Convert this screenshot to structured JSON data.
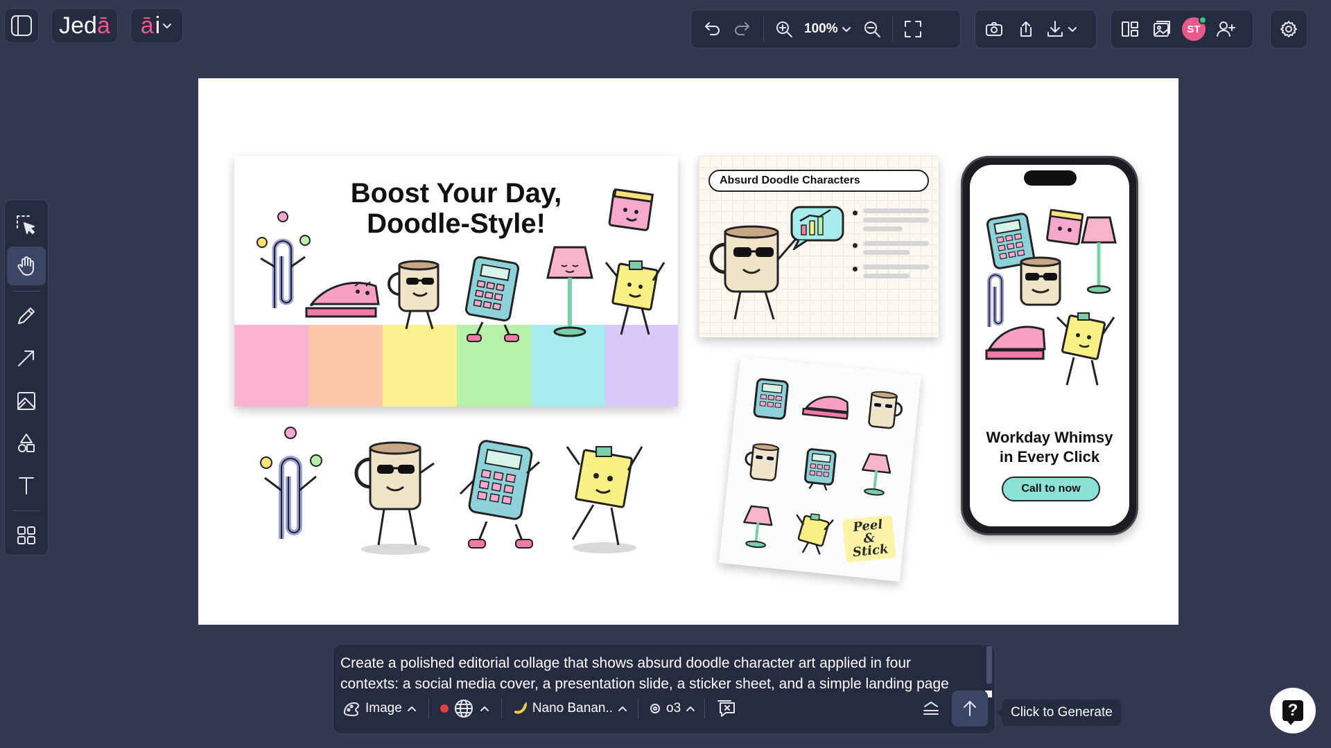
{
  "app": {
    "logo_main": "Jed",
    "logo_accent": "ā",
    "ai_main": "ā",
    "ai_tail": "i"
  },
  "toolbar": {
    "zoom_value": "100%"
  },
  "user": {
    "initials": "ST"
  },
  "canvas": {
    "social": {
      "title_line1": "Boost Your Day,",
      "title_line2": "Doodle-Style!"
    },
    "slide": {
      "title": "Absurd Doodle Characters"
    },
    "sticker_sheet": {
      "label_line1": "Peel &",
      "label_line2": "Stick"
    },
    "phone": {
      "headline_line1": "Workday Whimsy",
      "headline_line2": "in Every Click",
      "cta": "Call to now"
    }
  },
  "prompt": {
    "text": "Create a polished editorial collage that shows absurd doodle character art applied in four contexts: a social media cover, a presentation slide, a sticker sheet, and a simple landing page",
    "mode_label": "Image",
    "model_label": "Nano Banan..",
    "reasoning_label": "o3",
    "generate_tooltip": "Click to Generate"
  },
  "help": {
    "glyph": "?"
  },
  "colors": {
    "background": "#323852",
    "panel": "#262b40",
    "accent_pink": "#e85a8c",
    "cta_teal": "#8de0d4",
    "record_red": "#e53e3e"
  }
}
